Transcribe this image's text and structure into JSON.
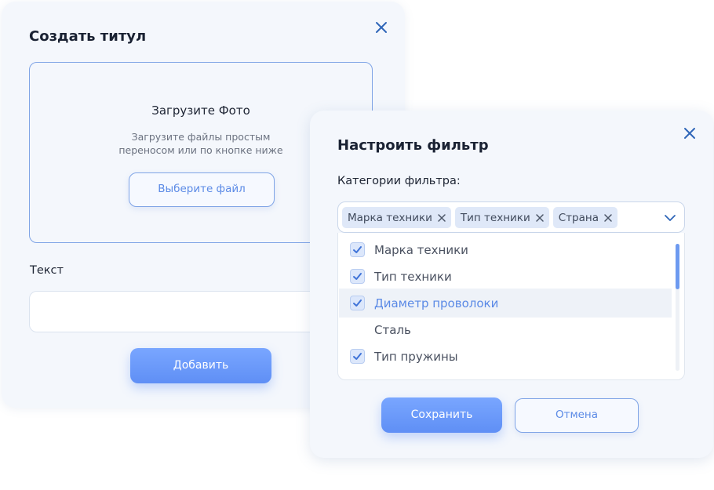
{
  "create_dialog": {
    "title": "Создать титул",
    "upload": {
      "title": "Загрузите Фото",
      "description_line1": "Загрузите файлы простым",
      "description_line2": "переносом или по кнопке ниже",
      "choose_file_label": "Выберите файл"
    },
    "text_label": "Текст",
    "text_value": "",
    "add_label": "Добавить"
  },
  "filter_dialog": {
    "title": "Настроить фильтр",
    "categories_label": "Категории фильтра:",
    "selected_tags": [
      "Марка техники",
      "Тип техники",
      "Страна"
    ],
    "options": [
      {
        "label": "Марка техники",
        "checked": true
      },
      {
        "label": "Тип техники",
        "checked": true
      },
      {
        "label": "Диаметр проволоки",
        "checked": true,
        "highlighted": true
      },
      {
        "label": "Сталь",
        "checked": false
      },
      {
        "label": "Тип пружины",
        "checked": true
      }
    ],
    "save_label": "Сохранить",
    "cancel_label": "Отмена"
  },
  "colors": {
    "accent": "#5f8ff5",
    "accent_light": "#79a6ff",
    "border_blue": "#7fa4e6",
    "dialog_bg": "#f4f7fc",
    "tag_bg": "#dfe8f8",
    "title_text": "#1a2233"
  },
  "icons": {
    "close": "close-icon",
    "tag_remove": "tag-remove-icon",
    "dropdown": "chevron-down-icon",
    "checkbox": "checkmark-icon"
  }
}
